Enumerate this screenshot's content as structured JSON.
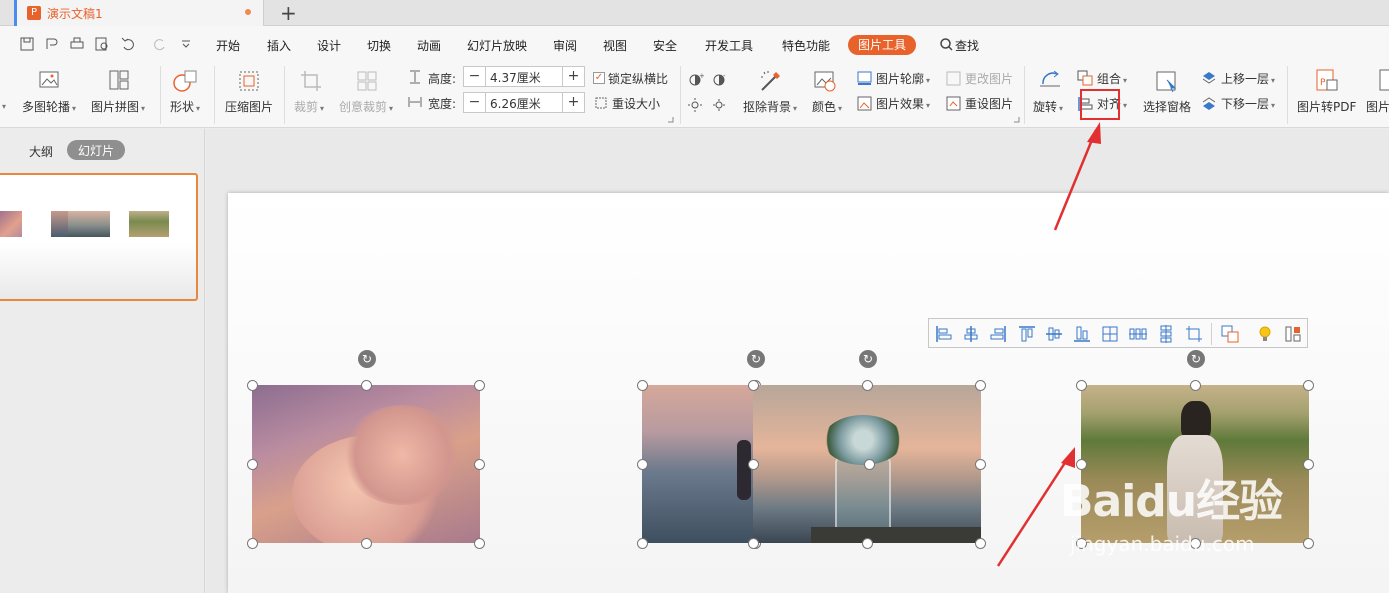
{
  "document_tab": {
    "title": "演示文稿1",
    "app_icon": "presentation-icon"
  },
  "new_tab_label": "+",
  "menu": {
    "items": [
      "开始",
      "插入",
      "设计",
      "切换",
      "动画",
      "幻灯片放映",
      "审阅",
      "视图",
      "安全",
      "开发工具",
      "特色功能"
    ],
    "active_item": "图片工具",
    "search": "查找"
  },
  "ribbon": {
    "multi_carousel": "多图轮播",
    "picture_collage": "图片拼图",
    "shape": "形状",
    "compress": "压缩图片",
    "crop": "裁剪",
    "creative_crop": "创意裁剪",
    "height_label": "高度:",
    "height_value": "4.37厘米",
    "width_label": "宽度:",
    "width_value": "6.26厘米",
    "lock_ratio": "锁定纵横比",
    "lock_ratio_checked": true,
    "reset_size": "重设大小",
    "remove_bg": "抠除背景",
    "color": "颜色",
    "outline": "图片轮廓",
    "effect": "图片效果",
    "change_pic": "更改图片",
    "reset_pic": "重设图片",
    "rotate": "旋转",
    "align": "对齐",
    "group": "组合",
    "selection_pane": "选择窗格",
    "bring_forward": "上移一层",
    "send_backward": "下移一层",
    "to_pdf": "图片转PDF",
    "more": "图片"
  },
  "left_panel": {
    "outline_tab": "大纲",
    "slides_tab": "幻灯片"
  },
  "watermark": {
    "brand": "Baidu经验",
    "url": "jingyan.baidu.com"
  },
  "colors": {
    "accent": "#e8622b",
    "highlight": "#e23030",
    "toolbar_bg": "#f7f7f7",
    "align_icon": "#3a78c9"
  }
}
